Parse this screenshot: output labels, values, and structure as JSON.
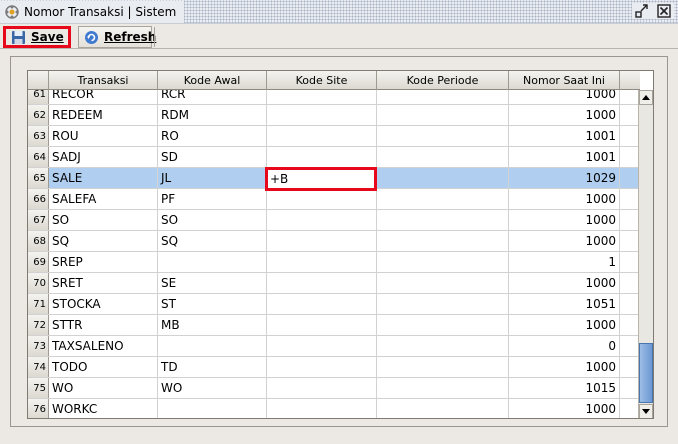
{
  "window": {
    "title": "Nomor Transaksi | Sistem"
  },
  "toolbar": {
    "save_label": "Save",
    "refresh_label": "Refresh"
  },
  "table": {
    "columns": [
      "Transaksi",
      "Kode Awal",
      "Kode Site",
      "Kode Periode",
      "Nomor Saat Ini"
    ],
    "rows": [
      {
        "n": "61",
        "transaksi": "RECOR",
        "kode_awal": "RCR",
        "kode_site": "",
        "kode_periode": "",
        "nomor": "1000"
      },
      {
        "n": "62",
        "transaksi": "REDEEM",
        "kode_awal": "RDM",
        "kode_site": "",
        "kode_periode": "",
        "nomor": "1000"
      },
      {
        "n": "63",
        "transaksi": "ROU",
        "kode_awal": "RO",
        "kode_site": "",
        "kode_periode": "",
        "nomor": "1001"
      },
      {
        "n": "64",
        "transaksi": "SADJ",
        "kode_awal": "SD",
        "kode_site": "",
        "kode_periode": "",
        "nomor": "1001"
      },
      {
        "n": "65",
        "transaksi": "SALE",
        "kode_awal": "JL",
        "kode_site": "",
        "kode_periode": "",
        "nomor": "1029",
        "selected": true
      },
      {
        "n": "66",
        "transaksi": "SALEFA",
        "kode_awal": "PF",
        "kode_site": "",
        "kode_periode": "",
        "nomor": "1000"
      },
      {
        "n": "67",
        "transaksi": "SO",
        "kode_awal": "SO",
        "kode_site": "",
        "kode_periode": "",
        "nomor": "1000"
      },
      {
        "n": "68",
        "transaksi": "SQ",
        "kode_awal": "SQ",
        "kode_site": "",
        "kode_periode": "",
        "nomor": "1000"
      },
      {
        "n": "69",
        "transaksi": "SREP",
        "kode_awal": "",
        "kode_site": "",
        "kode_periode": "",
        "nomor": "1"
      },
      {
        "n": "70",
        "transaksi": "SRET",
        "kode_awal": "SE",
        "kode_site": "",
        "kode_periode": "",
        "nomor": "1000"
      },
      {
        "n": "71",
        "transaksi": "STOCKA",
        "kode_awal": "ST",
        "kode_site": "",
        "kode_periode": "",
        "nomor": "1051"
      },
      {
        "n": "72",
        "transaksi": "STTR",
        "kode_awal": "MB",
        "kode_site": "",
        "kode_periode": "",
        "nomor": "1000"
      },
      {
        "n": "73",
        "transaksi": "TAXSALENO",
        "kode_awal": "",
        "kode_site": "",
        "kode_periode": "",
        "nomor": "0"
      },
      {
        "n": "74",
        "transaksi": "TODO",
        "kode_awal": "TD",
        "kode_site": "",
        "kode_periode": "",
        "nomor": "1000"
      },
      {
        "n": "75",
        "transaksi": "WO",
        "kode_awal": "WO",
        "kode_site": "",
        "kode_periode": "",
        "nomor": "1015"
      },
      {
        "n": "76",
        "transaksi": "WORKC",
        "kode_awal": "",
        "kode_site": "",
        "kode_periode": "",
        "nomor": "1000"
      }
    ]
  },
  "editor": {
    "value": "+B"
  },
  "colors": {
    "selection": "#b0cff0",
    "highlight": "#e8081b"
  },
  "icons": {
    "title": "cycle-icon",
    "minimize": "minimize-icon",
    "close": "close-icon",
    "save": "floppy-disk-icon",
    "refresh": "refresh-icon"
  }
}
